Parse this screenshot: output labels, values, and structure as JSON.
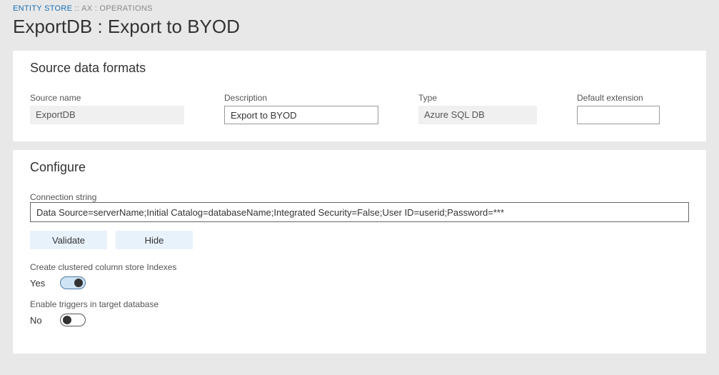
{
  "breadcrumb": {
    "link": "ENTITY STORE",
    "sep": " :: ",
    "rest": "AX : OPERATIONS"
  },
  "page_title": "ExportDB : Export to BYOD",
  "source_panel": {
    "title": "Source data formats",
    "fields": {
      "source_name": {
        "label": "Source name",
        "value": "ExportDB"
      },
      "description": {
        "label": "Description",
        "value": "Export to BYOD"
      },
      "type": {
        "label": "Type",
        "value": "Azure SQL DB"
      },
      "default_ext": {
        "label": "Default extension",
        "value": ""
      }
    }
  },
  "configure_panel": {
    "title": "Configure",
    "connection": {
      "label": "Connection string",
      "value": "Data Source=serverName;Initial Catalog=databaseName;Integrated Security=False;User ID=userid;Password=***"
    },
    "buttons": {
      "validate": "Validate",
      "hide": "Hide"
    },
    "toggle1": {
      "label": "Create clustered column store Indexes",
      "value": "Yes",
      "on": true
    },
    "toggle2": {
      "label": "Enable triggers in target database",
      "value": "No",
      "on": false
    }
  }
}
